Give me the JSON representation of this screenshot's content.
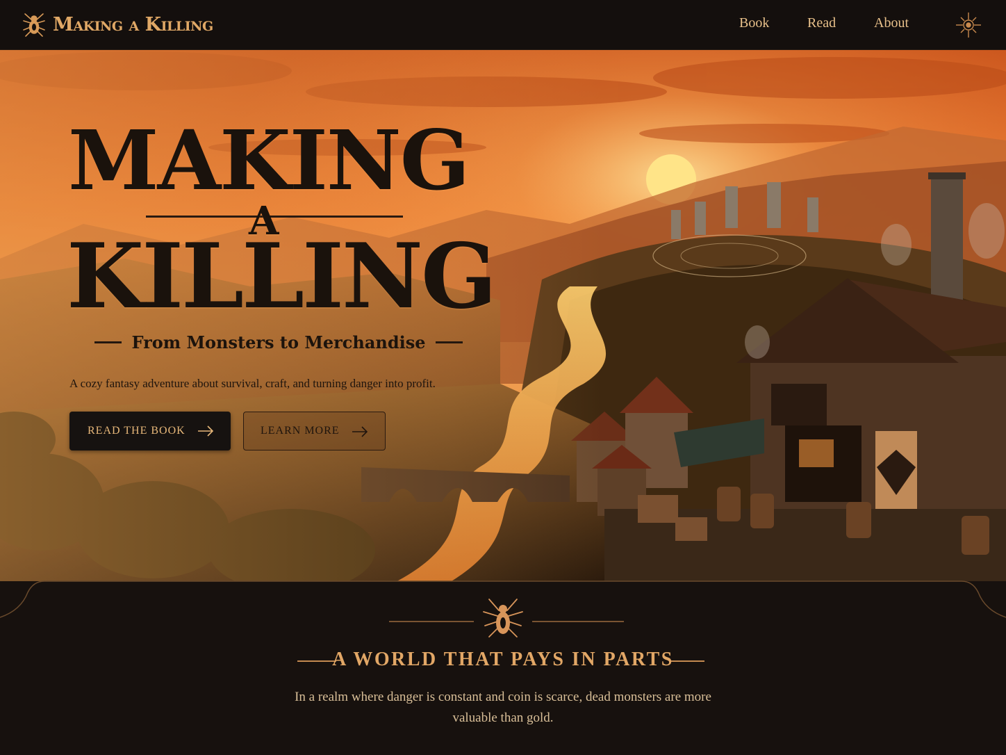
{
  "nav": {
    "brand": "Making a Killing",
    "links": [
      "Book",
      "Read",
      "About"
    ]
  },
  "hero": {
    "title_line1": "MAKING",
    "title_line2": "A",
    "title_line3": "KILLING",
    "subtitle": "From Monsters to Merchandise",
    "tagline": "A cozy fantasy adventure about survival, craft, and turning danger into profit.",
    "primary_button": "READ THE BOOK",
    "secondary_button": "LEARN MORE"
  },
  "section": {
    "heading": "A WORLD THAT PAYS IN PARTS",
    "body": "In a realm where danger is constant and coin is scarce, dead monsters are more valuable than gold."
  },
  "colors": {
    "accent": "#e2a766",
    "dark": "#151110",
    "sky": "#f08a3a"
  }
}
